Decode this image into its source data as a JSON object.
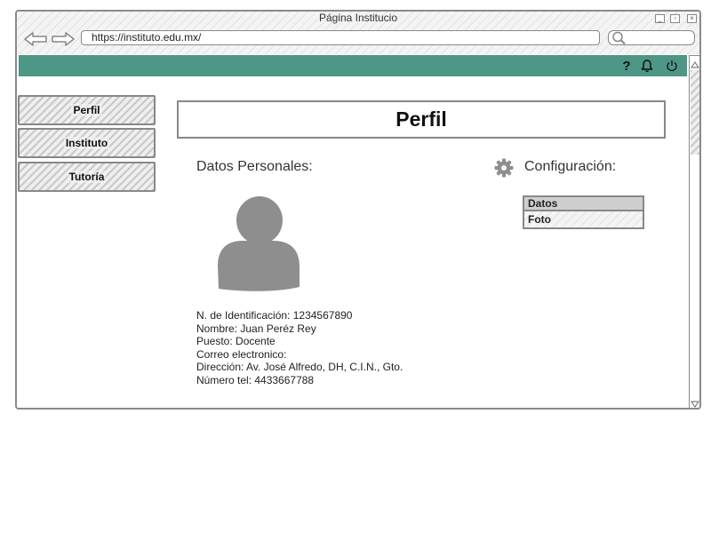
{
  "window": {
    "title": "Página Institucio"
  },
  "browser": {
    "url": "https://instituto.edu.mx/"
  },
  "appbar": {
    "icons": [
      "help-icon",
      "bell-icon",
      "power-icon"
    ],
    "help_label": "?",
    "color": "#4e9685"
  },
  "sidebar": {
    "items": [
      {
        "label": "Perfil"
      },
      {
        "label": "Instituto"
      },
      {
        "label": "Tutoría"
      }
    ]
  },
  "main": {
    "title": "Perfil",
    "personal": {
      "heading": "Datos Personales:",
      "id_line": "N. de Identificación: 1234567890",
      "name_line": "Nombre: Juan Peréz Rey",
      "role_line": "Puesto: Docente",
      "email_line": "Correo electronico:",
      "address_line": "Dirección: Av. José Alfredo, DH, C.I.N., Gto.",
      "phone_line": "Número tel: 4433667788"
    },
    "config": {
      "heading": "Configuración:",
      "items": [
        {
          "label": "Datos"
        },
        {
          "label": "Foto"
        }
      ]
    }
  }
}
